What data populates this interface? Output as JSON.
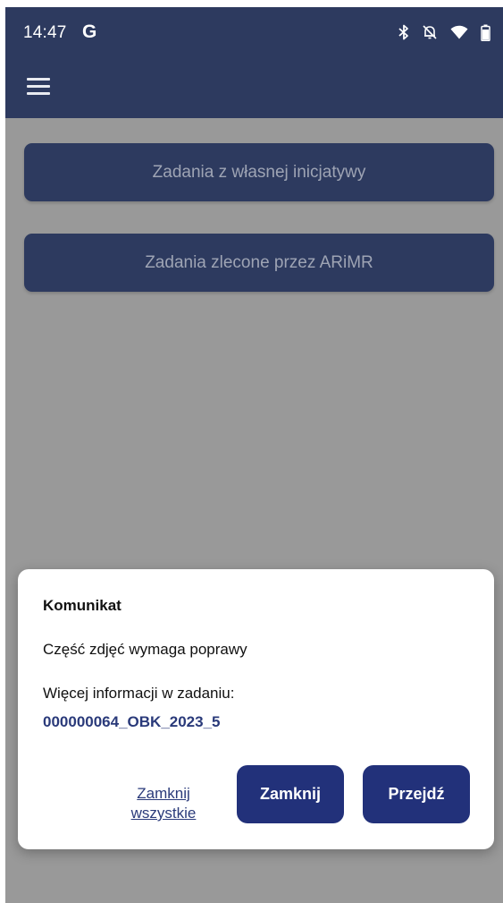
{
  "status_bar": {
    "time": "14:47",
    "google_badge": "G",
    "icons": [
      "bluetooth-icon",
      "notifications-off-icon",
      "wifi-icon",
      "battery-icon"
    ]
  },
  "app_bar": {
    "menu_icon": "hamburger-menu-icon"
  },
  "main": {
    "buttons": [
      {
        "label": "Zadania z własnej inicjatywy"
      },
      {
        "label": "Zadania zlecone przez ARiMR"
      }
    ]
  },
  "dialog": {
    "title": "Komunikat",
    "message": "Część zdjęć wymaga poprawy",
    "info_label": "Więcej informacji w zadaniu:",
    "task_link": "000000064_OBK_2023_5",
    "close_all_label": "Zamknij wszystkie",
    "close_label": "Zamknij",
    "go_label": "Przejdź"
  },
  "colors": {
    "app_bar": "#2d3a5f",
    "overlay": "#999999",
    "dialog_button": "#22317a",
    "link": "#2a3a7a"
  }
}
